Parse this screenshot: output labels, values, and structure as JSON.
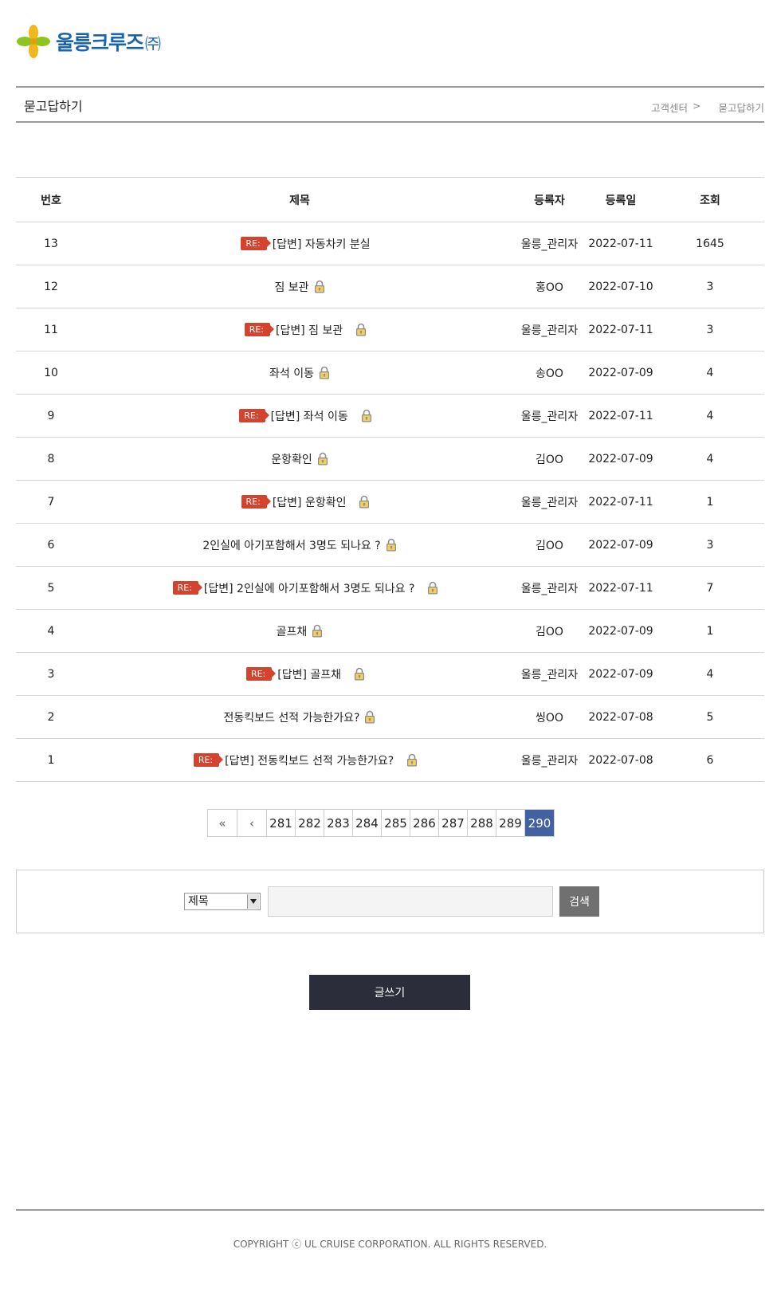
{
  "logo": {
    "text": "울릉크루즈",
    "suffix": "㈜"
  },
  "header": {
    "title": "묻고답하기",
    "breadcrumb": [
      {
        "label": "고객센터",
        "sep": ">"
      },
      {
        "label": "묻고답하기"
      }
    ]
  },
  "table": {
    "columns": {
      "no": "번호",
      "subject": "제목",
      "author": "등록자",
      "date": "등록일",
      "views": "조회"
    },
    "re_badge": "RE:",
    "rows": [
      {
        "no": "13",
        "subject": "[답변] 자동차키 분실",
        "author": "울릉_관리자",
        "date": "2022-07-11",
        "views": "1645",
        "reply": true,
        "locked": false
      },
      {
        "no": "12",
        "subject": "짐 보관",
        "author": "홍OO",
        "date": "2022-07-10",
        "views": "3",
        "reply": false,
        "locked": true
      },
      {
        "no": "11",
        "subject": "[답변] 짐 보관",
        "author": "울릉_관리자",
        "date": "2022-07-11",
        "views": "3",
        "reply": true,
        "locked": true
      },
      {
        "no": "10",
        "subject": "좌석 이동",
        "author": "송OO",
        "date": "2022-07-09",
        "views": "4",
        "reply": false,
        "locked": true
      },
      {
        "no": "9",
        "subject": "[답변] 좌석 이동",
        "author": "울릉_관리자",
        "date": "2022-07-11",
        "views": "4",
        "reply": true,
        "locked": true
      },
      {
        "no": "8",
        "subject": "운항확인",
        "author": "김OO",
        "date": "2022-07-09",
        "views": "4",
        "reply": false,
        "locked": true
      },
      {
        "no": "7",
        "subject": "[답변] 운항확인",
        "author": "울릉_관리자",
        "date": "2022-07-11",
        "views": "1",
        "reply": true,
        "locked": true
      },
      {
        "no": "6",
        "subject": "2인실에 아기포함해서 3명도 되나요 ?",
        "author": "김OO",
        "date": "2022-07-09",
        "views": "3",
        "reply": false,
        "locked": true
      },
      {
        "no": "5",
        "subject": "[답변] 2인실에 아기포함해서 3명도 되나요 ?",
        "author": "울릉_관리자",
        "date": "2022-07-11",
        "views": "7",
        "reply": true,
        "locked": true
      },
      {
        "no": "4",
        "subject": "골프채",
        "author": "김OO",
        "date": "2022-07-09",
        "views": "1",
        "reply": false,
        "locked": true
      },
      {
        "no": "3",
        "subject": "[답변] 골프채",
        "author": "울릉_관리자",
        "date": "2022-07-09",
        "views": "4",
        "reply": true,
        "locked": true
      },
      {
        "no": "2",
        "subject": "전동킥보드 선적 가능한가요?",
        "author": "씽OO",
        "date": "2022-07-08",
        "views": "5",
        "reply": false,
        "locked": true
      },
      {
        "no": "1",
        "subject": "[답변] 전동킥보드 선적 가능한가요?",
        "author": "울릉_관리자",
        "date": "2022-07-08",
        "views": "6",
        "reply": true,
        "locked": true
      }
    ]
  },
  "pagination": {
    "first": "«",
    "prev": "‹",
    "pages": [
      "281",
      "282",
      "283",
      "284",
      "285",
      "286",
      "287",
      "288",
      "289",
      "290"
    ],
    "current": "290"
  },
  "search": {
    "select_value": "제목",
    "input_value": "",
    "button_label": "검색"
  },
  "write_button": "글쓰기",
  "footer": {
    "copyright": "COPYRIGHT ⓒ UL CRUISE CORPORATION. ALL RIGHTS RESERVED."
  },
  "colors": {
    "brand": "#1a63ae",
    "re_badge": "#d4432d",
    "active_page": "#4261a3",
    "write_button": "#2c2d3b",
    "search_button": "#6f706f"
  },
  "icons": {
    "logo": "clover-logo-icon",
    "lock": "lock-icon",
    "dropdown": "chevron-down-icon"
  }
}
